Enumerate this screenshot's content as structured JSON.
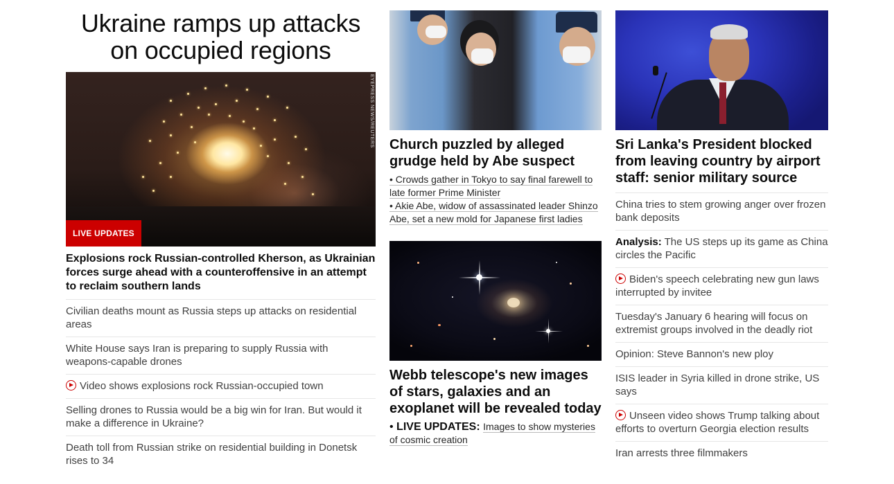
{
  "lead": {
    "headline": "Ukraine ramps up attacks on occupied regions",
    "image_credit": "EYEPRESS NEWS/REUTERS",
    "badge": "LIVE UPDATES",
    "subheadline": "Explosions rock Russian-controlled Kherson, as Ukrainian forces surge ahead with a counteroffensive in an attempt to reclaim southern lands",
    "list": [
      {
        "text": "Civilian deaths mount as Russia steps up attacks on residential areas",
        "video": false
      },
      {
        "text": "White House says Iran is preparing to supply Russia with weapons-capable drones",
        "video": false
      },
      {
        "text": "Video shows explosions rock Russian-occupied town",
        "video": true
      },
      {
        "text": "Selling drones to Russia would be a big win for Iran. But would it make a difference in Ukraine?",
        "video": false
      },
      {
        "text": "Death toll from Russian strike on residential building in Donetsk rises to 34",
        "video": false
      }
    ]
  },
  "abe": {
    "title": "Church puzzled by alleged grudge held by Abe suspect",
    "bullets": [
      {
        "prefix": "• ",
        "label": "",
        "text": "Crowds gather in Tokyo to say final farewell to late former Prime Minister"
      },
      {
        "prefix": "• ",
        "label": "",
        "text": "Akie Abe, widow of assassinated leader Shinzo Abe, set a new mold for Japanese first ladies"
      }
    ]
  },
  "webb": {
    "title": "Webb telescope's new images of stars, galaxies and an exoplanet will be revealed today",
    "bullets": [
      {
        "prefix": "• ",
        "label": "LIVE UPDATES:",
        "text": "Images to show mysteries of cosmic creation"
      }
    ]
  },
  "lanka": {
    "title": "Sri Lanka's President blocked from leaving country by airport staff: senior military source",
    "list": [
      {
        "label": "",
        "text": "China tries to stem growing anger over frozen bank deposits",
        "video": false
      },
      {
        "label": "Analysis:",
        "text": "The US steps up its game as China circles the Pacific",
        "video": false
      },
      {
        "label": "",
        "text": "Biden's speech celebrating new gun laws interrupted by invitee",
        "video": true
      },
      {
        "label": "",
        "text": "Tuesday's January 6 hearing will focus on extremist groups involved in the deadly riot",
        "video": false
      },
      {
        "label": "",
        "text": "Opinion: Steve Bannon's new ploy",
        "video": false
      },
      {
        "label": "",
        "text": "ISIS leader in Syria killed in drone strike, US says",
        "video": false
      },
      {
        "label": "",
        "text": "Unseen video shows Trump talking about efforts to overturn Georgia election results",
        "video": true
      },
      {
        "label": "",
        "text": "Iran arrests three filmmakers",
        "video": false
      }
    ]
  },
  "colors": {
    "live_red": "#cc0000",
    "text": "#0c0c0c",
    "secondary_text": "#404040",
    "divider": "#e6e6e6"
  },
  "icons": {
    "video": "play-circle-icon"
  }
}
